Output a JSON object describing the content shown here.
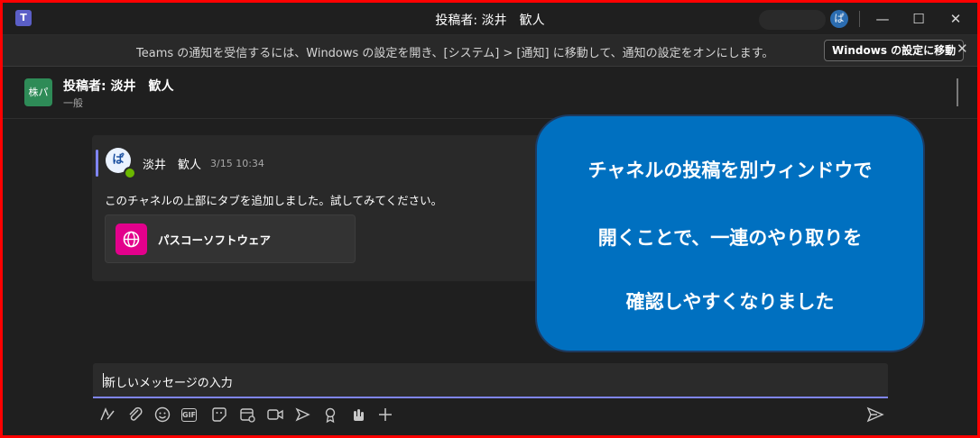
{
  "window": {
    "title": "投稿者: 淡井　歓人",
    "logo_text": "T",
    "avatar_initial": "ぱ",
    "controls": {
      "minimize": "—",
      "maximize": "☐",
      "close": "✕"
    }
  },
  "notification": {
    "text": "Teams の通知を受信するには、Windows の設定を開き、[システム] > [通知] に移動して、通知の設定をオンにします。",
    "button_label": "Windows の設定に移動",
    "close_glyph": "✕"
  },
  "channel": {
    "team_tile": "株パ",
    "title": "投稿者: 淡井　歓人",
    "subtitle": "一般"
  },
  "post": {
    "avatar_initial": "ぱ",
    "author": "淡井　歓人",
    "timestamp": "3/15 10:34",
    "body": "このチャネルの上部にタブを追加しました。試してみてください。",
    "tab_card_label": "パスコーソフトウェア"
  },
  "callout": {
    "lines": [
      "チャネルの投稿を別ウィンドウで",
      "開くことで、一連のやり取りを",
      "確認しやすくなりました"
    ]
  },
  "compose": {
    "placeholder": "新しいメッセージの入力",
    "toolbar": [
      {
        "name": "format-icon",
        "glyph": "A"
      },
      {
        "name": "attach-icon",
        "glyph": "⌕"
      },
      {
        "name": "emoji-icon",
        "glyph": "☺"
      },
      {
        "name": "gif-icon",
        "glyph": "GIF"
      },
      {
        "name": "sticker-icon",
        "glyph": "☻"
      },
      {
        "name": "schedule-meeting-icon",
        "glyph": "▣"
      },
      {
        "name": "video-icon",
        "glyph": "▭"
      },
      {
        "name": "stream-icon",
        "glyph": "▷"
      },
      {
        "name": "praise-icon",
        "glyph": "♆"
      },
      {
        "name": "apps-icon",
        "glyph": "✋"
      },
      {
        "name": "more-options-icon",
        "glyph": "+"
      }
    ]
  },
  "colors": {
    "accent": "#7f85f5",
    "callout": "#0070c0",
    "team_tile": "#2e8b57",
    "tab_icon": "#e3008c",
    "frame_border": "#ff0000"
  }
}
